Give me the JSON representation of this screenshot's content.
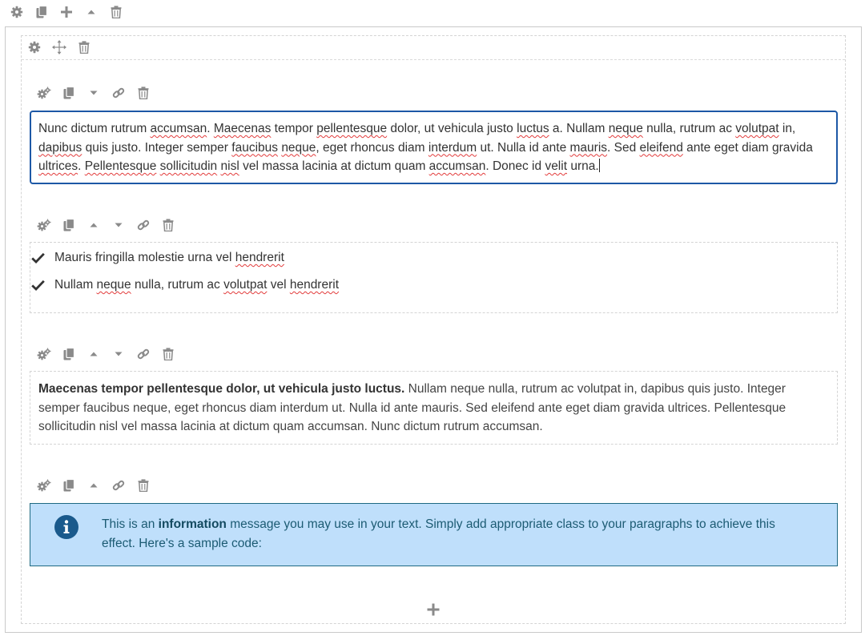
{
  "text_block_1": {
    "segments": [
      "Nunc dictum rutrum ",
      "accumsan",
      ". ",
      "Maecenas",
      " tempor ",
      "pellentesque",
      " dolor, ut vehicula justo ",
      "luctus",
      " a. Nullam ",
      "neque",
      " nulla, rutrum ac ",
      "volutpat",
      " in, ",
      "dapibus",
      " quis justo. Integer semper ",
      "faucibus",
      " ",
      "neque",
      ", eget rhoncus diam ",
      "interdum",
      " ut. Nulla id ante ",
      "mauris",
      ". Sed ",
      "eleifend",
      " ante eget diam gravida ",
      "ultrices",
      ". ",
      "Pellentesque",
      " ",
      "sollicitudin",
      " ",
      "nisl",
      " vel massa lacinia at dictum quam ",
      "accumsan",
      ". Donec id ",
      "velit",
      " urna."
    ]
  },
  "list": {
    "items": [
      {
        "parts": [
          "Mauris fringilla molestie urna vel ",
          "hendrerit"
        ]
      },
      {
        "parts": [
          "Nullam ",
          "neque",
          " nulla, rutrum ac ",
          "volutpat",
          " vel ",
          "hendrerit"
        ]
      }
    ]
  },
  "text_block_2": {
    "bold": "Maecenas tempor pellentesque dolor, ut vehicula justo luctus.",
    "rest": " Nullam neque nulla, rutrum ac volutpat in, dapibus quis justo. Integer semper faucibus neque, eget rhoncus diam interdum ut. Nulla id ante mauris. Sed eleifend ante eget diam gravida ultrices. Pellentesque sollicitudin nisl vel massa lacinia at dictum quam accumsan. Nunc dictum rutrum accumsan."
  },
  "info_message": {
    "prefix": "This is an ",
    "bold": "information",
    "suffix": " message you may use in your text. Simply add appropriate class to your paragraphs to achieve this effect. Here's a sample code:"
  },
  "icons": {
    "top_toolbar": [
      "gear-icon",
      "copy-icon",
      "plus-icon",
      "caret-up-icon",
      "trash-icon"
    ],
    "row_toolbar": [
      "gear-icon",
      "move-icon",
      "trash-icon"
    ],
    "block_1_toolbar": [
      "gears-icon",
      "copy-icon",
      "caret-down-icon",
      "link-icon",
      "trash-icon"
    ],
    "block_2_toolbar": [
      "gears-icon",
      "copy-icon",
      "caret-up-icon",
      "caret-down-icon",
      "link-icon",
      "trash-icon"
    ],
    "block_3_toolbar": [
      "gears-icon",
      "copy-icon",
      "caret-up-icon",
      "caret-down-icon",
      "link-icon",
      "trash-icon"
    ],
    "block_4_toolbar": [
      "gears-icon",
      "copy-icon",
      "caret-up-icon",
      "link-icon",
      "trash-icon"
    ],
    "list_bullet": "check-icon",
    "info": "info-circle-icon",
    "add_block": "plus-icon"
  },
  "colors": {
    "focus_border": "#1d58a6",
    "spellcheck": "#e23b3b",
    "info_bg": "#bfdffb",
    "info_border": "#1f6a82",
    "info_text": "#1c5b73",
    "info_icon": "#1a5a8c",
    "icon_gray": "#8a8a8a"
  }
}
